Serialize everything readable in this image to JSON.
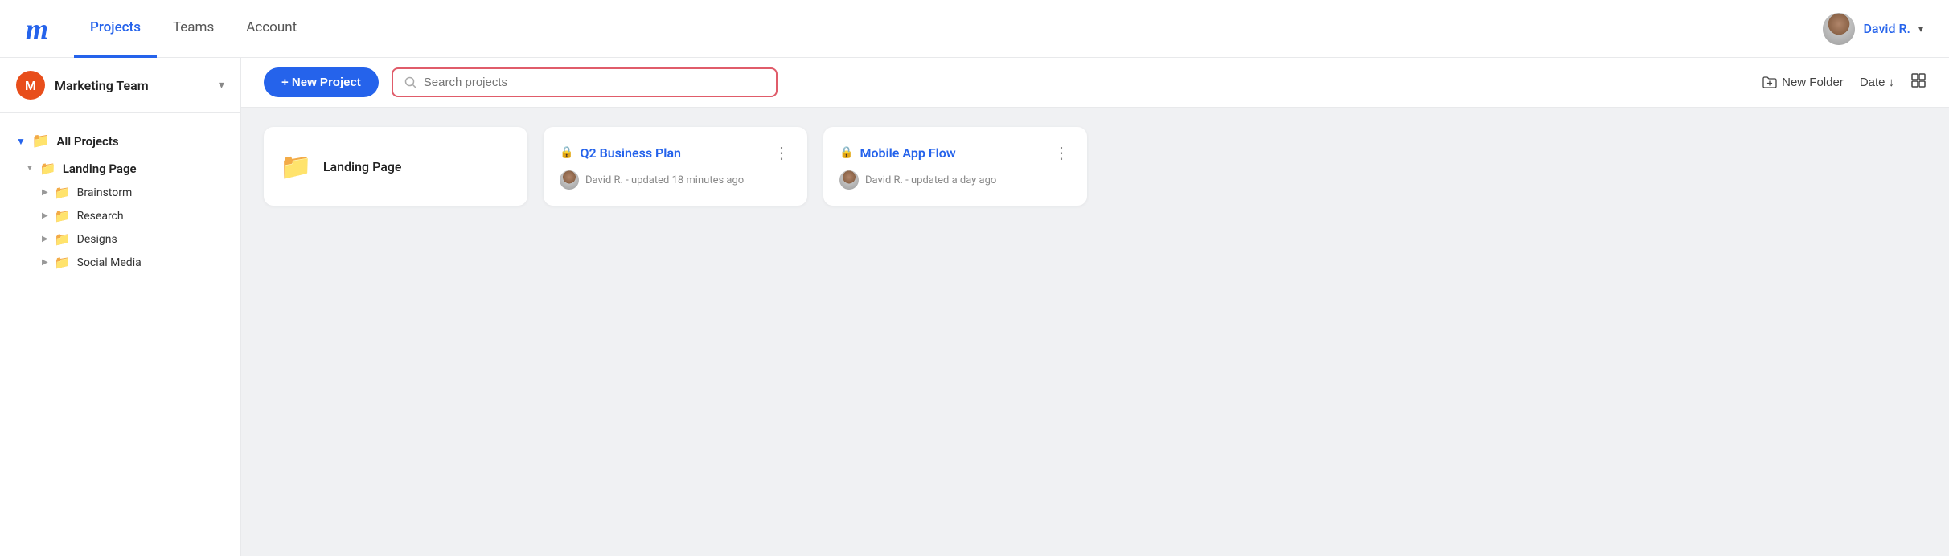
{
  "nav": {
    "logo": "m",
    "tabs": [
      {
        "label": "Projects",
        "active": true
      },
      {
        "label": "Teams",
        "active": false
      },
      {
        "label": "Account",
        "active": false
      }
    ],
    "user": {
      "name": "David R.",
      "chevron": "▾"
    }
  },
  "sidebar": {
    "team": {
      "initial": "M",
      "name": "Marketing Team"
    },
    "all_projects_label": "All Projects",
    "tree": {
      "landing_page_label": "Landing Page",
      "children": [
        {
          "label": "Brainstorm"
        },
        {
          "label": "Research"
        },
        {
          "label": "Designs"
        },
        {
          "label": "Social Media"
        }
      ]
    }
  },
  "toolbar": {
    "new_project_label": "+ New Project",
    "search_placeholder": "Search projects",
    "new_folder_label": "New Folder",
    "date_sort_label": "Date",
    "sort_arrow": "↓"
  },
  "projects": [
    {
      "type": "folder",
      "name": "Landing Page"
    },
    {
      "type": "project",
      "title": "Q2 Business Plan",
      "meta": "David R. - updated 18 minutes ago"
    },
    {
      "type": "project",
      "title": "Mobile App Flow",
      "meta": "David R. - updated a day ago"
    }
  ]
}
